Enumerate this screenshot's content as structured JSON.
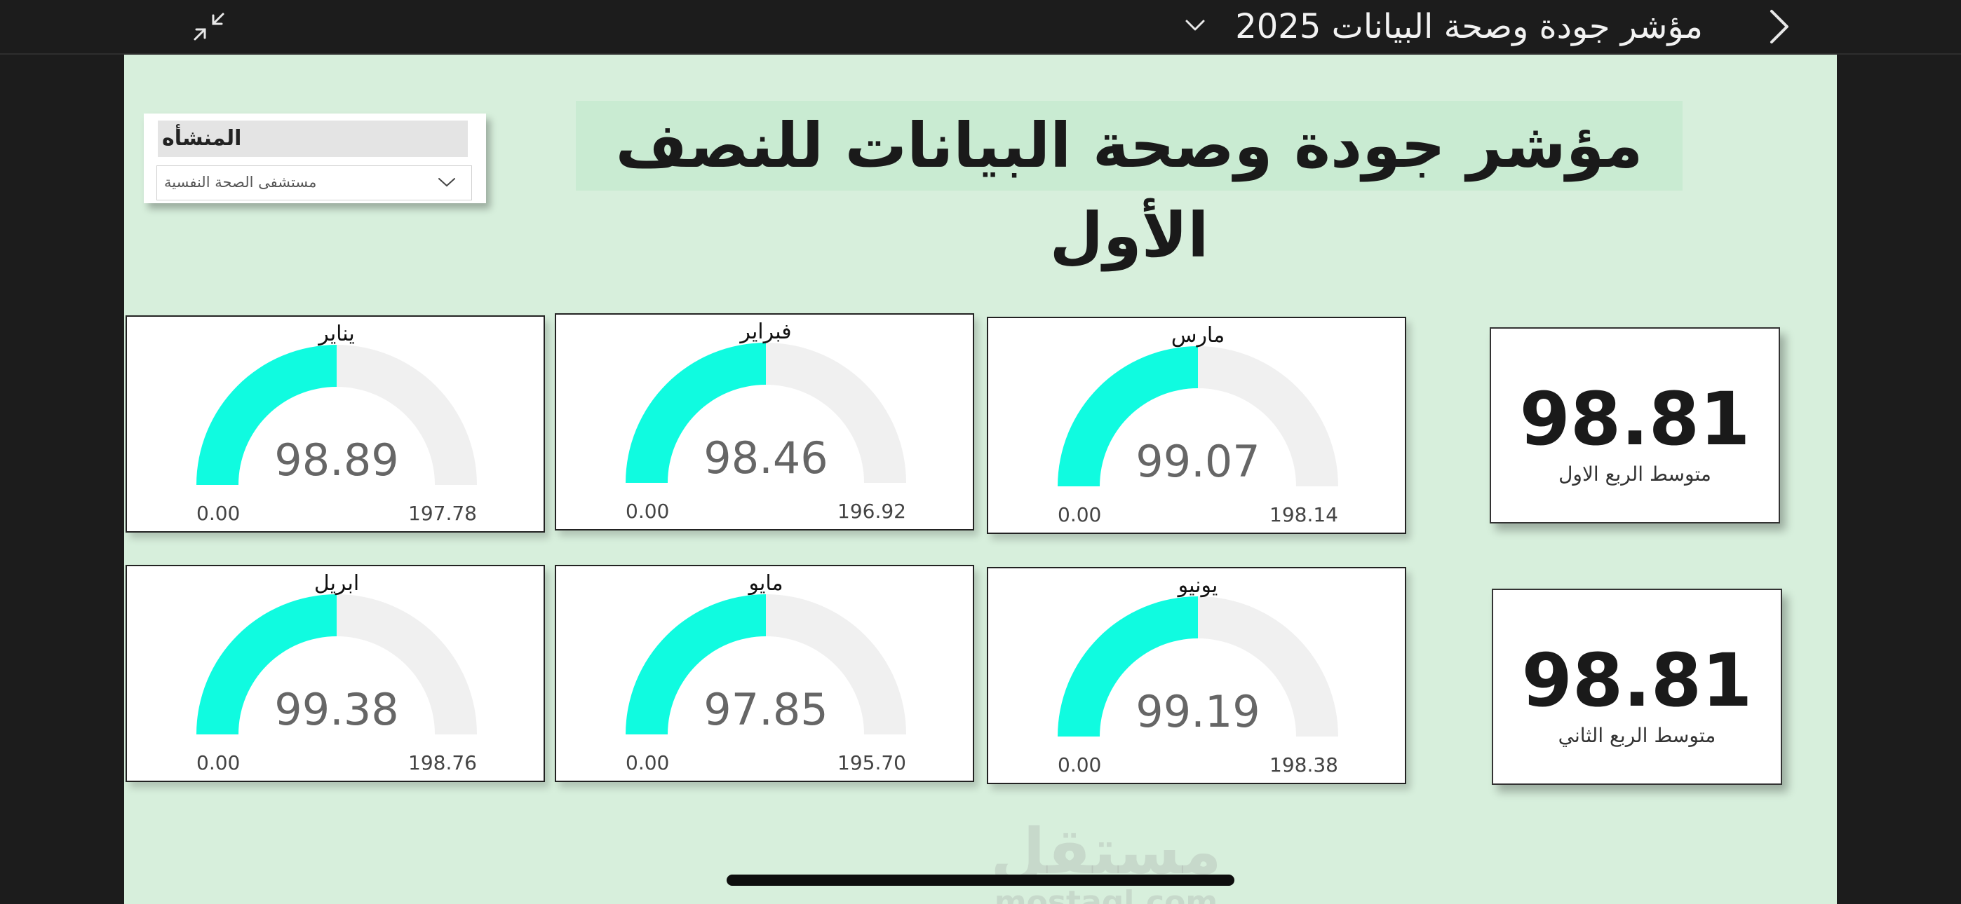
{
  "topbar": {
    "report_title": "مؤشر جودة وصحة البيانات 2025",
    "icons": {
      "collapse": "collapse-arrows-icon",
      "title_dropdown": "chevron-down-icon",
      "back": "chevron-right-icon"
    }
  },
  "slicer": {
    "header": "المنشأه",
    "selected_value": "مستشفى الصحة النفسية",
    "icon": "chevron-down-icon"
  },
  "headline": "مؤشر جودة وصحة البيانات للنصف الأول",
  "gauges": [
    {
      "month": "يناير",
      "value": "98.89",
      "min": "0.00",
      "max": "197.78",
      "fraction": 0.5
    },
    {
      "month": "فبراير",
      "value": "98.46",
      "min": "0.00",
      "max": "196.92",
      "fraction": 0.5
    },
    {
      "month": "مارس",
      "value": "99.07",
      "min": "0.00",
      "max": "198.14",
      "fraction": 0.5
    },
    {
      "month": "ابريل",
      "value": "99.38",
      "min": "0.00",
      "max": "198.76",
      "fraction": 0.5
    },
    {
      "month": "مايو",
      "value": "97.85",
      "min": "0.00",
      "max": "195.70",
      "fraction": 0.5
    },
    {
      "month": "يونيو",
      "value": "99.19",
      "min": "0.00",
      "max": "198.38",
      "fraction": 0.5
    }
  ],
  "kpis": [
    {
      "value": "98.81",
      "label": "متوسط الربع الاول"
    },
    {
      "value": "98.81",
      "label": "متوسط الربع الثاني"
    }
  ],
  "watermark": {
    "arabic": "مستقل",
    "latin": "mostaql.com"
  },
  "colors": {
    "gauge_fill": "#10fbe0",
    "gauge_track": "#f0f0f0",
    "canvas_bg": "#d7efdc",
    "headline_bg": "#c9ebd2"
  }
}
